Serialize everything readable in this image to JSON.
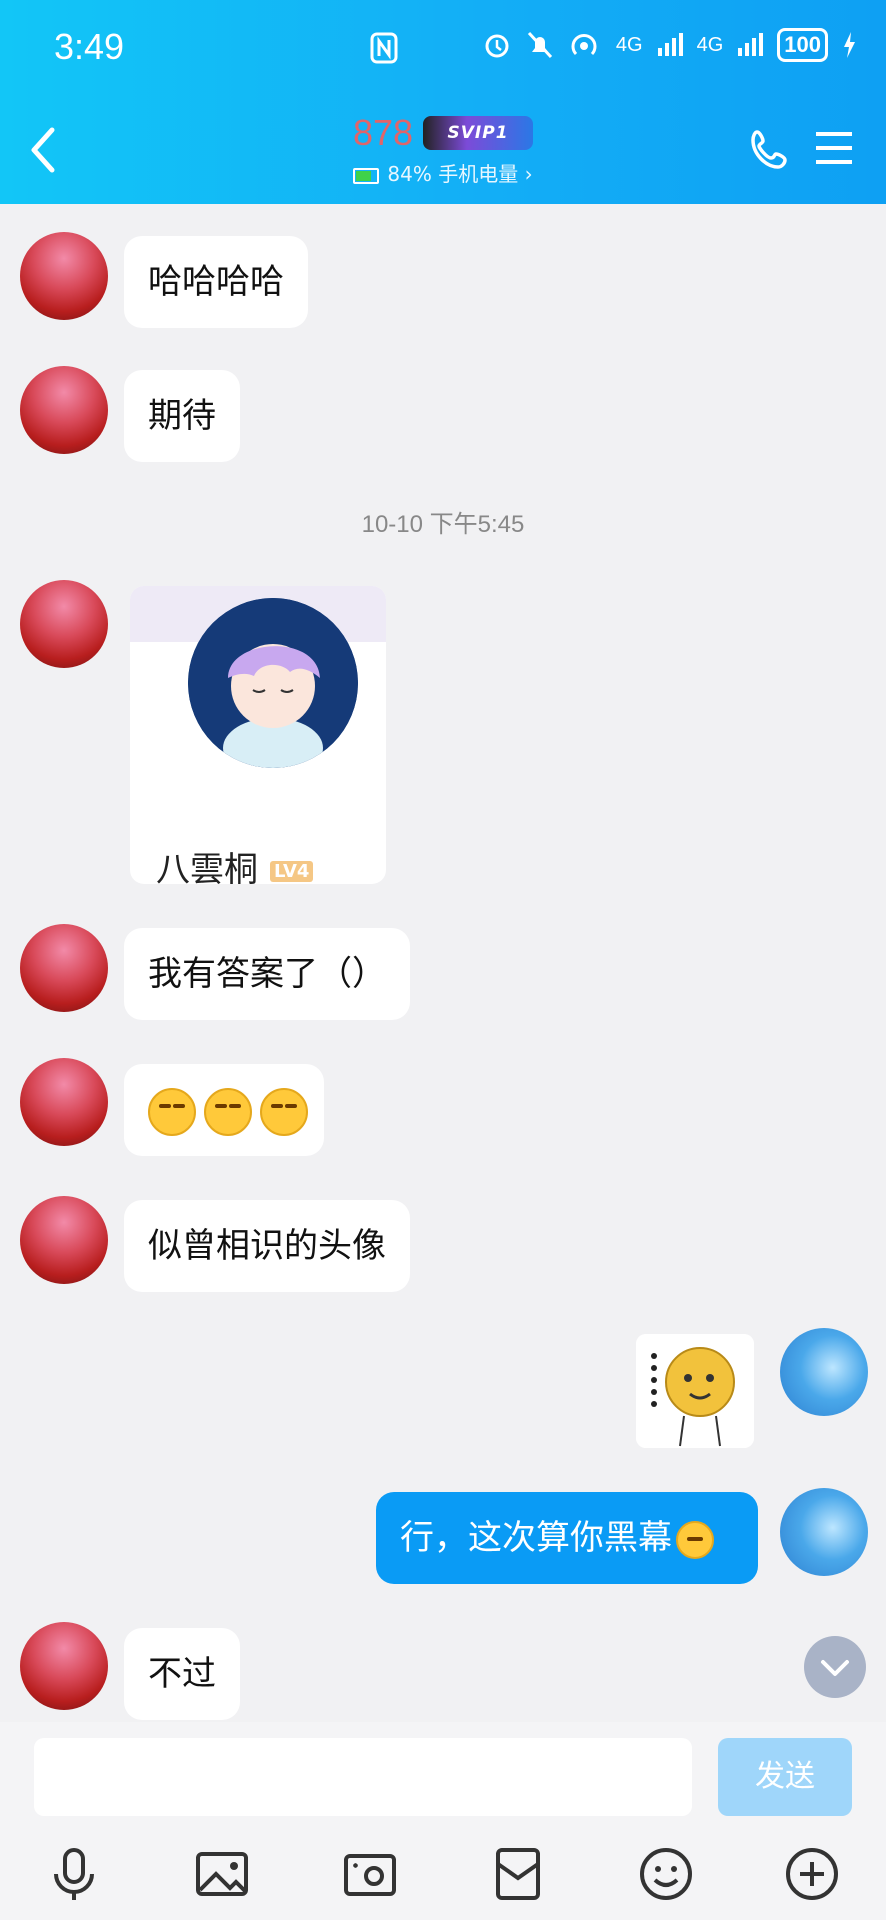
{
  "status_bar": {
    "time": "3:49",
    "net1": "4G",
    "net2": "4G",
    "battery": "100"
  },
  "header": {
    "title": "878",
    "badge": "SVIP1",
    "subtitle": "84% 手机电量 ›"
  },
  "messages": [
    {
      "text": "哈哈哈哈"
    },
    {
      "text": "期待"
    },
    {
      "timestamp": "10-10 下午5:45"
    },
    {
      "card_name": "八雲桐",
      "card_level": "LV4"
    },
    {
      "text": "我有答案了（）"
    },
    {
      "emoji_count": 3
    },
    {
      "text": "似曾相识的头像"
    },
    {
      "sticker": true
    },
    {
      "text_me": "行，这次算你黑幕"
    },
    {
      "text": "不过"
    }
  ],
  "composer": {
    "input_value": "",
    "send_label": "发送"
  },
  "colors": {
    "header": "#12b4f6",
    "my_bubble": "#0a9bf5",
    "send_disabled": "#9fd6fa"
  }
}
